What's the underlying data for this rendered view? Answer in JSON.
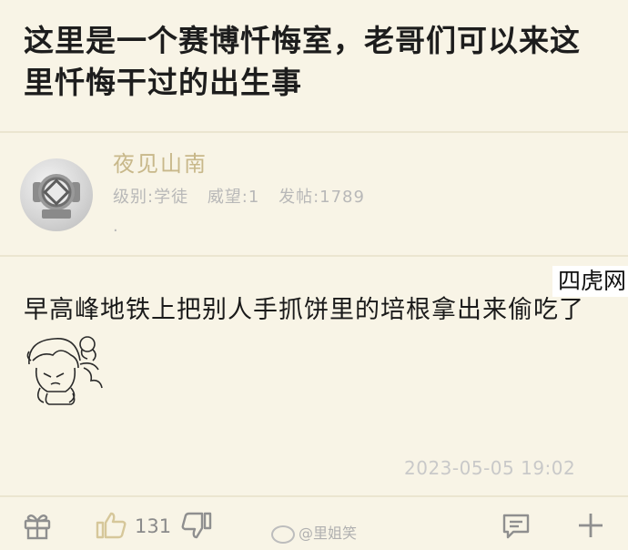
{
  "thread": {
    "title": "这里是一个赛博忏悔室，老哥们可以来这里忏悔干过的出生事"
  },
  "author": {
    "name": "夜见山南",
    "level": "级别:学徒",
    "prestige": "威望:1",
    "posts": "发帖:1789",
    "extra": "."
  },
  "post": {
    "text": "早高峰地铁上把别人手抓饼里的培根拿出来偷吃了",
    "time": "2023-05-05 19:02"
  },
  "watermark": {
    "corner": "四虎网",
    "weibo": "@里姐笑"
  },
  "actions": {
    "like_count": "131"
  },
  "icons": [
    "gift-icon",
    "thumbs-up-icon",
    "thumbs-down-icon",
    "comment-icon",
    "plus-icon"
  ],
  "colors": {
    "background": "#f8f4e6",
    "author_name": "#c8b88a",
    "accent_like": "#d6c79a"
  }
}
